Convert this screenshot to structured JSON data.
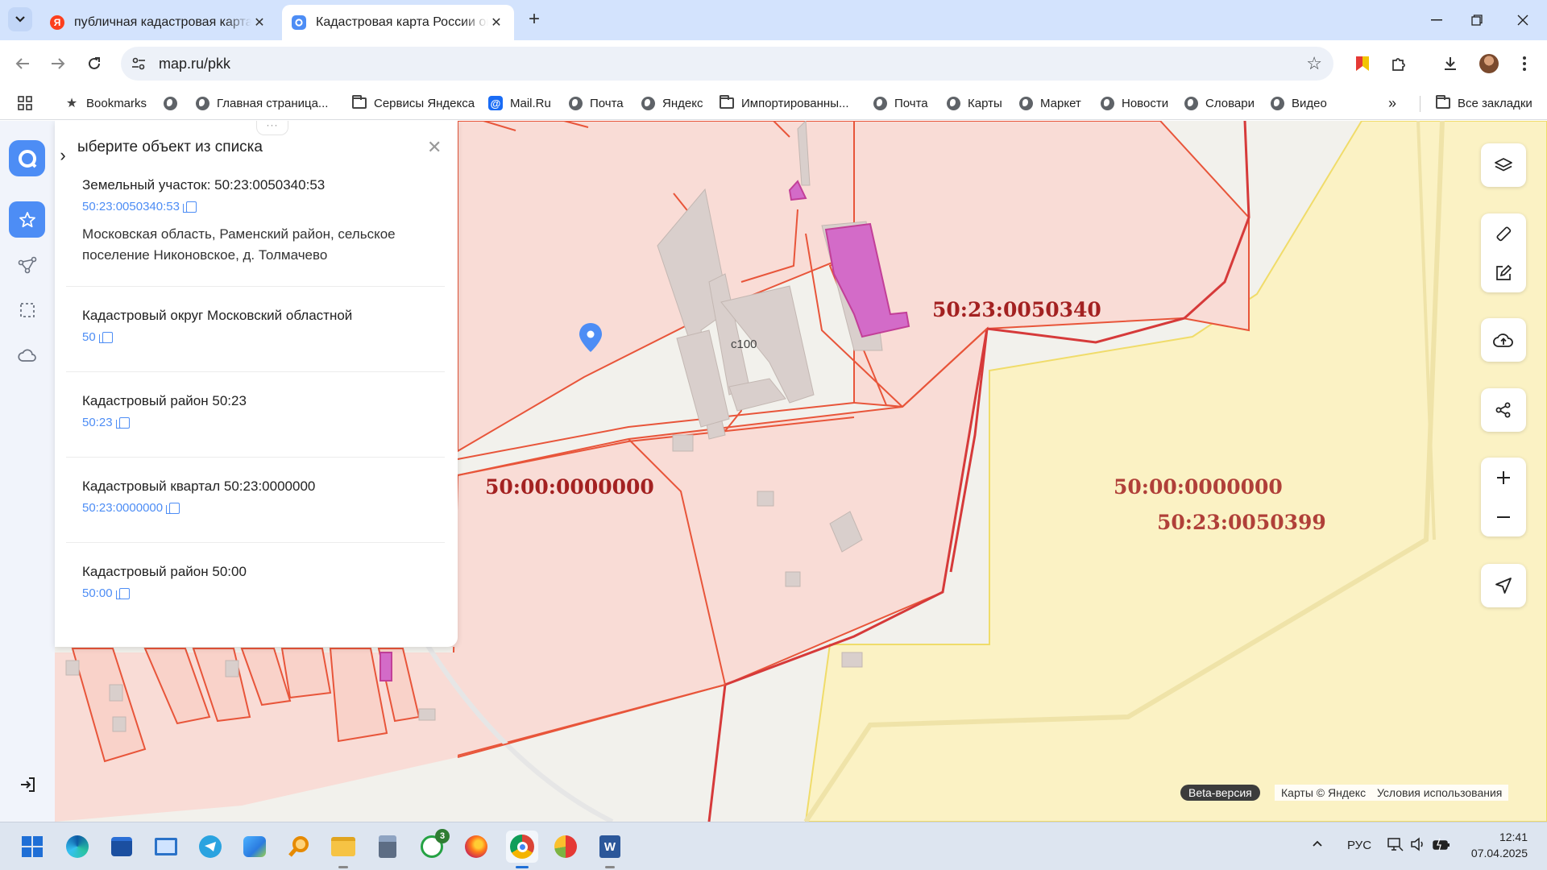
{
  "browser": {
    "tabs": [
      {
        "title": "публичная кадастровая карта",
        "favicon": "Я",
        "active": false
      },
      {
        "title": "Кадастровая карта России онлайн",
        "active": true
      }
    ],
    "url": "map.ru/pkk",
    "bookmarks": [
      {
        "label": "Bookmarks",
        "icon": "star-icon"
      },
      {
        "label": "",
        "icon": "globe-icon"
      },
      {
        "label": "Главная страница...",
        "icon": "globe-icon"
      },
      {
        "label": "Сервисы Яндекса",
        "icon": "folder-icon"
      },
      {
        "label": "Mail.Ru",
        "icon": "mailru-icon"
      },
      {
        "label": "Почта",
        "icon": "globe-icon"
      },
      {
        "label": "Яндекс",
        "icon": "globe-icon"
      },
      {
        "label": "Импортированны...",
        "icon": "folder-icon"
      },
      {
        "label": "Почта",
        "icon": "globe-icon"
      },
      {
        "label": "Карты",
        "icon": "globe-icon"
      },
      {
        "label": "Маркет",
        "icon": "globe-icon"
      },
      {
        "label": "Новости",
        "icon": "globe-icon"
      },
      {
        "label": "Словари",
        "icon": "globe-icon"
      },
      {
        "label": "Видео",
        "icon": "globe-icon"
      }
    ],
    "all_bookmarks": "Все закладки"
  },
  "panel": {
    "title": "ыберите объект из списка",
    "items": [
      {
        "title": "Земельный участок: 50:23:0050340:53",
        "number": "50:23:0050340:53",
        "address": "Московская область, Раменский район, сельское поселение Никоновское, д. Толмачево"
      },
      {
        "title": "Кадастровый округ Московский областной",
        "number": "50"
      },
      {
        "title": "Кадастровый район 50:23",
        "number": "50:23"
      },
      {
        "title": "Кадастровый квартал 50:23:0000000",
        "number": "50:23:0000000"
      },
      {
        "title": "Кадастровый район 50:00",
        "number": "50:00"
      }
    ]
  },
  "map": {
    "labels": {
      "quarter_main": "50:23:0050340",
      "district_left": "50:00:0000000",
      "district_right": "50:00:0000000",
      "quarter_right": "50:23:0050399",
      "building": "с100"
    },
    "attribution": {
      "beta": "Beta-версия",
      "copyright": "Карты © Яндекс",
      "terms": "Условия использования"
    },
    "colors": {
      "parcel_fill": "#f9dcd6",
      "parcel_border": "#e8553a",
      "quarter_border": "#d63a3a",
      "yellow_zone": "#fbf2c4",
      "building_fill": "#d9cfcc",
      "highlight": "#d36bc8",
      "label": "#a32121",
      "accent": "#4d8df5"
    }
  },
  "taskbar": {
    "whatsapp_badge": "3",
    "language": "РУС",
    "time": "12:41",
    "date": "07.04.2025"
  }
}
